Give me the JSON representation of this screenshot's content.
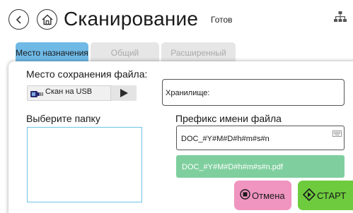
{
  "header": {
    "title": "Сканирование",
    "status": "Готов"
  },
  "icons": {
    "back": "back-arrow-icon",
    "home": "home-icon",
    "network": "network-icon",
    "usb": "usb-icon",
    "play": "play-icon",
    "keyboard": "keyboard-icon",
    "cancel": "stop-icon",
    "start": "start-diamond-icon"
  },
  "tabs": [
    {
      "label": "Место назначения",
      "active": true
    },
    {
      "label": "Общий",
      "active": false
    },
    {
      "label": "Расширенный",
      "active": false
    }
  ],
  "form": {
    "save_location_label": "Место сохранения файла:",
    "usb_option": "Скан на USB",
    "storage_label": "Хранилище:",
    "folder_label": "Выберите папку",
    "prefix_label": "Префикс имени файла",
    "prefix_value": "DOC_#Y#M#D#h#m#s#n",
    "filename_preview": "DOC_#Y#M#D#h#m#s#n.pdf"
  },
  "buttons": {
    "cancel": "Отмена",
    "start": "СТАРТ"
  },
  "colors": {
    "tab_active": "#6fb9e6",
    "tab_inactive": "#e6e6e6",
    "preview_bg": "#7fcf9e",
    "cancel_bg": "#f094c0",
    "start_bg": "#6ecb3e",
    "folder_border": "#6fc3e8"
  }
}
